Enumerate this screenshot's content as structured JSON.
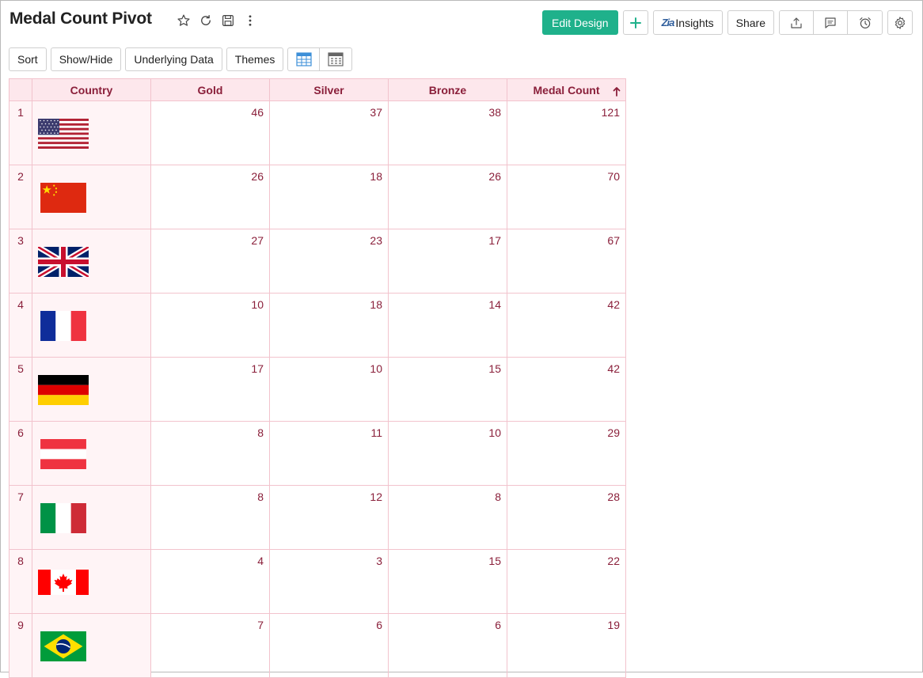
{
  "header": {
    "title": "Medal Count Pivot",
    "edit_design_label": "Edit Design",
    "insights_label": "Insights",
    "share_label": "Share"
  },
  "toolbar": {
    "sort_label": "Sort",
    "show_hide_label": "Show/Hide",
    "underlying_data_label": "Underlying Data",
    "themes_label": "Themes"
  },
  "table": {
    "columns": [
      "Country",
      "Gold",
      "Silver",
      "Bronze",
      "Medal Count"
    ],
    "sorted_column": "Medal Count",
    "rows": [
      {
        "index": "1",
        "flag": "usa-flag-icon",
        "gold": "46",
        "silver": "37",
        "bronze": "38",
        "total": "121"
      },
      {
        "index": "2",
        "flag": "china-flag-icon",
        "gold": "26",
        "silver": "18",
        "bronze": "26",
        "total": "70"
      },
      {
        "index": "3",
        "flag": "uk-flag-icon",
        "gold": "27",
        "silver": "23",
        "bronze": "17",
        "total": "67"
      },
      {
        "index": "4",
        "flag": "france-flag-icon",
        "gold": "10",
        "silver": "18",
        "bronze": "14",
        "total": "42"
      },
      {
        "index": "5",
        "flag": "germany-flag-icon",
        "gold": "17",
        "silver": "10",
        "bronze": "15",
        "total": "42"
      },
      {
        "index": "6",
        "flag": "austria-flag-icon",
        "gold": "8",
        "silver": "11",
        "bronze": "10",
        "total": "29"
      },
      {
        "index": "7",
        "flag": "italy-flag-icon",
        "gold": "8",
        "silver": "12",
        "bronze": "8",
        "total": "28"
      },
      {
        "index": "8",
        "flag": "canada-flag-icon",
        "gold": "4",
        "silver": "3",
        "bronze": "15",
        "total": "22"
      },
      {
        "index": "9",
        "flag": "brazil-flag-icon",
        "gold": "7",
        "silver": "6",
        "bronze": "6",
        "total": "19"
      }
    ]
  },
  "colors": {
    "primary": "#1fb18b",
    "header_bg": "#fde7ec",
    "cell_text": "#8a1f3a",
    "border": "#f2c3cd"
  }
}
